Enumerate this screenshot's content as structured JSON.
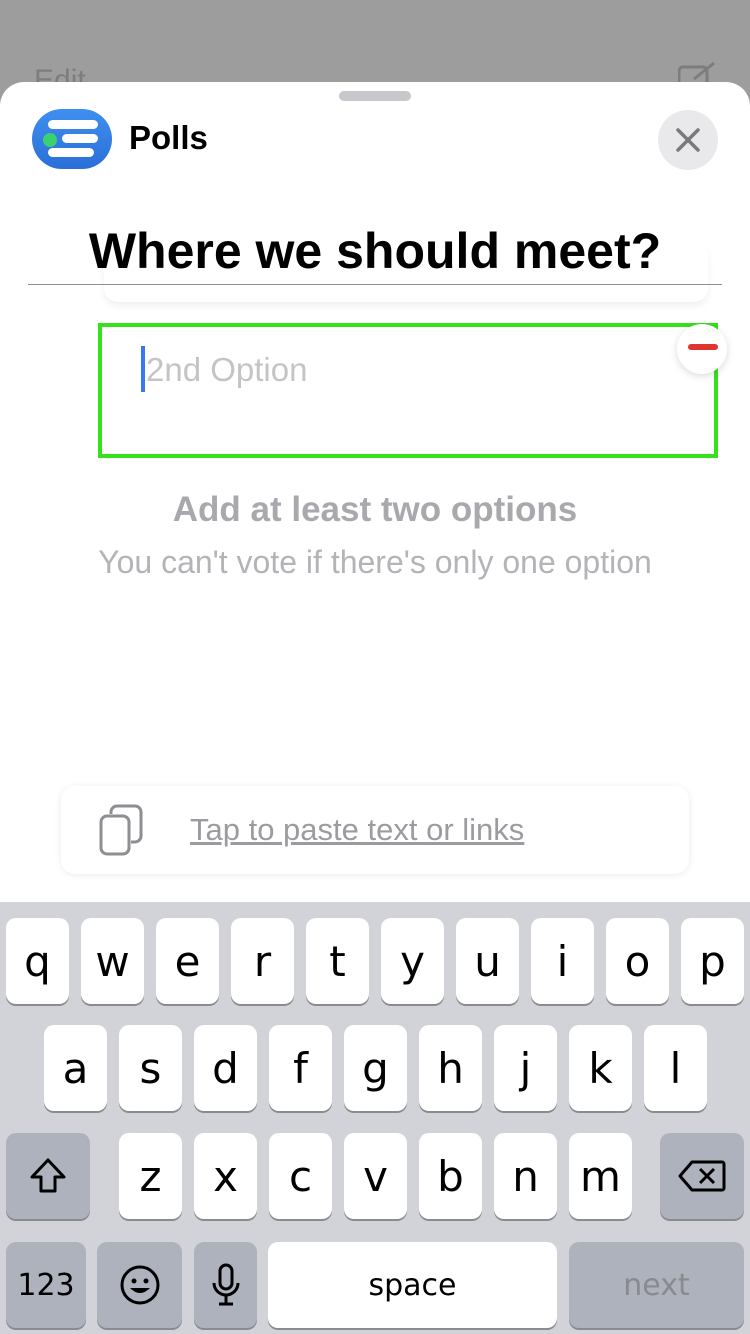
{
  "background": {
    "edit_label": "Edit"
  },
  "header": {
    "app_title": "Polls",
    "close_icon": "close-icon"
  },
  "poll": {
    "question": "Where we should meet?",
    "option_placeholder": "2nd Option",
    "hint_title": "Add at least two options",
    "hint_subtitle": "You can't vote if there's only one option"
  },
  "paste": {
    "label": "Tap to paste text or links",
    "icon": "clipboard-icon"
  },
  "keyboard": {
    "row1": [
      "q",
      "w",
      "e",
      "r",
      "t",
      "y",
      "u",
      "i",
      "o",
      "p"
    ],
    "row2": [
      "a",
      "s",
      "d",
      "f",
      "g",
      "h",
      "j",
      "k",
      "l"
    ],
    "row3": [
      "z",
      "x",
      "c",
      "v",
      "b",
      "n",
      "m"
    ],
    "numbers_label": "123",
    "space_label": "space",
    "return_label": "next"
  },
  "colors": {
    "focus_border": "#35e11b",
    "accent": "#3478f6",
    "remove": "#e0342f"
  }
}
